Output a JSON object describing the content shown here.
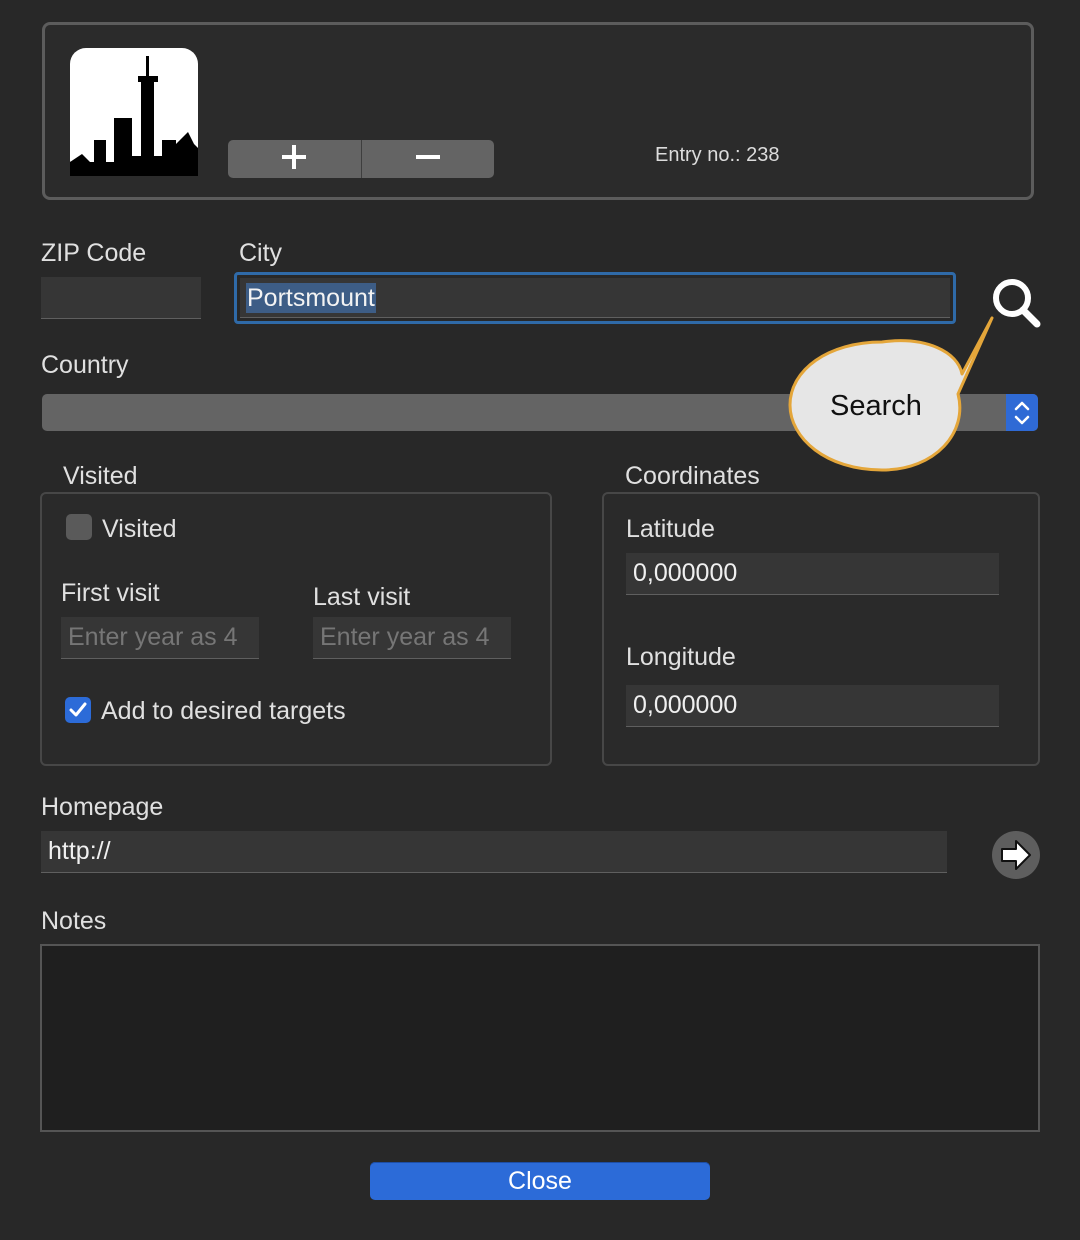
{
  "header": {
    "add_label": "+",
    "remove_label": "−",
    "entry_no": "Entry no.: 238"
  },
  "zip": {
    "label": "ZIP Code",
    "value": ""
  },
  "city": {
    "label": "City",
    "value": "Portsmount"
  },
  "search": {
    "icon": "search-icon",
    "tooltip": "Search"
  },
  "country": {
    "label": "Country",
    "value": ""
  },
  "visited_group": {
    "title": "Visited",
    "visited_checkbox_label": "Visited",
    "visited_checked": false,
    "first_visit_label": "First visit",
    "first_visit_placeholder": "Enter year as 4",
    "last_visit_label": "Last visit",
    "last_visit_placeholder": "Enter year as 4",
    "desired_label": "Add to desired targets",
    "desired_checked": true
  },
  "coordinates": {
    "title": "Coordinates",
    "latitude_label": "Latitude",
    "latitude_value": "0,000000",
    "longitude_label": "Longitude",
    "longitude_value": "0,000000"
  },
  "homepage": {
    "label": "Homepage",
    "value": "http://",
    "open_icon": "arrow-right-icon"
  },
  "notes": {
    "label": "Notes",
    "value": ""
  },
  "footer": {
    "close_label": "Close"
  },
  "colors": {
    "accent": "#2c6bd8",
    "selection": "#3d5d86",
    "tooltip_bg": "#e6e6e6",
    "tooltip_border": "#e4a63a"
  }
}
